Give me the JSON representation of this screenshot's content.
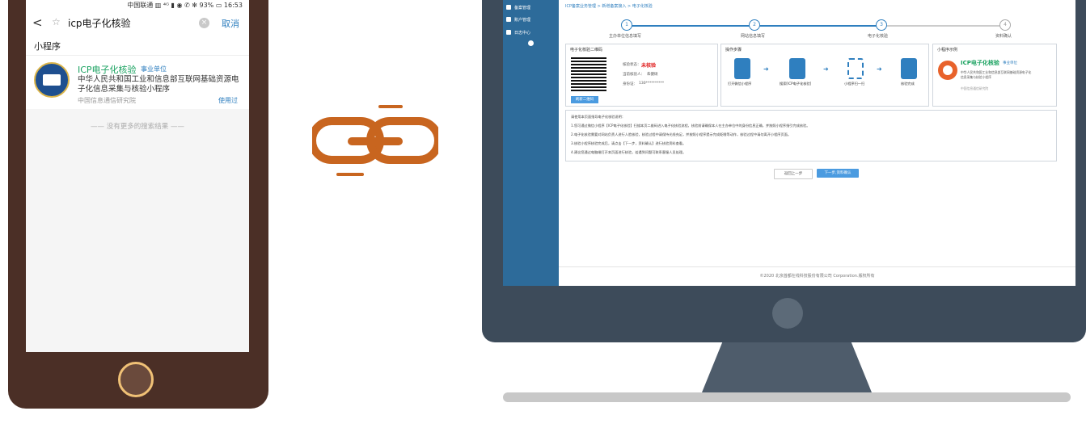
{
  "phone": {
    "status": "中国联通 ▥ ⁴ᴳ ▮ ◉ ✆ ✻ 93% ▭ 16:53",
    "back_glyph": "<",
    "star_glyph": "☆",
    "search_query": "icp电子化核验",
    "clear_glyph": "×",
    "cancel": "取消",
    "section": "小程序",
    "result": {
      "title": "ICP电子化核验",
      "tag": "事业单位",
      "desc": "中华人民共和国工业和信息部互联网基础资源电子化信息采集与核验小程序",
      "source": "中国信息通信研究院",
      "used": "使用过"
    },
    "no_more": "—— 没有更多的搜索结果 ——"
  },
  "monitor": {
    "sidebar": [
      {
        "label": "备案管理"
      },
      {
        "label": "账户管理"
      },
      {
        "label": "日志中心"
      }
    ],
    "breadcrumb": "ICP备案业务管理 > 新增备案接入 > 电子化核验",
    "steps": [
      {
        "num": "1",
        "label": "主办单位信息填写"
      },
      {
        "num": "2",
        "label": "网站信息填写"
      },
      {
        "num": "3",
        "label": "电子化核验"
      },
      {
        "num": "4",
        "label": "资料确认"
      }
    ],
    "qr_box": {
      "title": "电子化核验二维码",
      "status_label": "核验状态：",
      "status_value": "未核验",
      "person_label": "当前核验人：",
      "person_value": "朱健硕",
      "id_label": "身份证：",
      "id_value": "130**********",
      "refresh": "刷新二维码"
    },
    "ops_box": {
      "title": "操作步骤",
      "steps": [
        "打开微信小程序",
        "搜索[ICP电子化核验]",
        "小程序扫一扫",
        "核验完成"
      ]
    },
    "mini_box": {
      "title": "小程序示例",
      "name": "ICP电子化核验",
      "tag": "事业单位",
      "desc1": "中华人民共和国工业和信息部互联网基础资源电子化",
      "desc2": "信息采集与核验小程序",
      "source": "中国信息通信研究院"
    },
    "notes": [
      "请使用本页面指导电子化核验说明：",
      "1.您可通过微信小程序【ICP电子化核验】扫描本页二维码进入电子化核验流程，核验前请确保本人在主办单位中的身份信息正确，并按照小程序指引完成核验。",
      "2.电子化核验需要对网站负责人进行人脸核验，核验过程中请保持光线充足，并按照小程序提示完成眨眼等动作，核验过程中请勿离开小程序页面。",
      "3.核验小程序核验完成后，请点击【下一步，资料确认】进行核验资料查看。",
      "4.建议您通过电脑端打开本页面进行核验，若遇到问题可联系客服人员处理。"
    ],
    "btn_prev": "返回上一步",
    "btn_next": "下一步,资料确认",
    "footer": "©2020 北京首都在线科技股份有限公司 Corporation.版权所有"
  }
}
